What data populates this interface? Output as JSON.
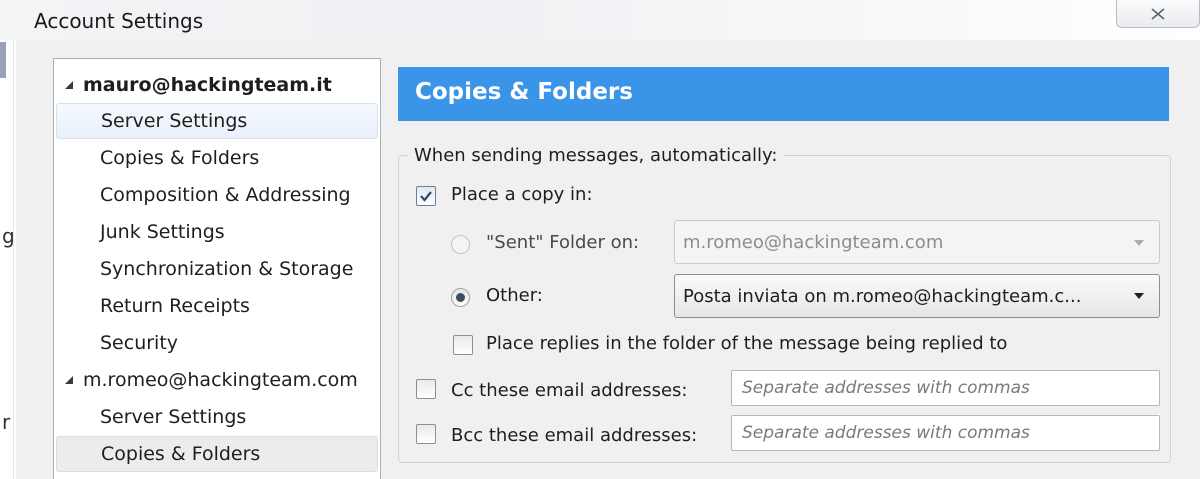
{
  "window": {
    "title": "Account Settings",
    "close_icon": "close-x-icon"
  },
  "background_fragments": [
    "g",
    "r"
  ],
  "tree": {
    "accounts": [
      {
        "name": "mauro@hackingteam.it",
        "expanded": true,
        "items": [
          "Server Settings",
          "Copies & Folders",
          "Composition & Addressing",
          "Junk Settings",
          "Synchronization & Storage",
          "Return Receipts",
          "Security"
        ]
      },
      {
        "name": "m.romeo@hackingteam.com",
        "expanded": true,
        "items": [
          "Server Settings",
          "Copies & Folders"
        ]
      }
    ],
    "selected_item": "m.romeo@hackingteam.com / Copies & Folders"
  },
  "header": {
    "title": "Copies & Folders",
    "color": "#3a95e8"
  },
  "sending": {
    "legend": "When sending messages, automatically:",
    "place_copy": {
      "label": "Place a copy in:",
      "checked": true
    },
    "sent_folder": {
      "label": "\"Sent\" Folder on:",
      "selected": false,
      "value": "m.romeo@hackingteam.com"
    },
    "other": {
      "label": "Other:",
      "selected": true,
      "value": "Posta inviata on m.romeo@hackingteam.c..."
    },
    "replies": {
      "label": "Place replies in the folder of the message being replied to",
      "checked": false
    },
    "cc": {
      "label": "Cc these email addresses:",
      "checked": false,
      "placeholder": "Separate addresses with commas"
    },
    "bcc": {
      "label": "Bcc these email addresses:",
      "checked": false,
      "placeholder": "Separate addresses with commas"
    }
  }
}
